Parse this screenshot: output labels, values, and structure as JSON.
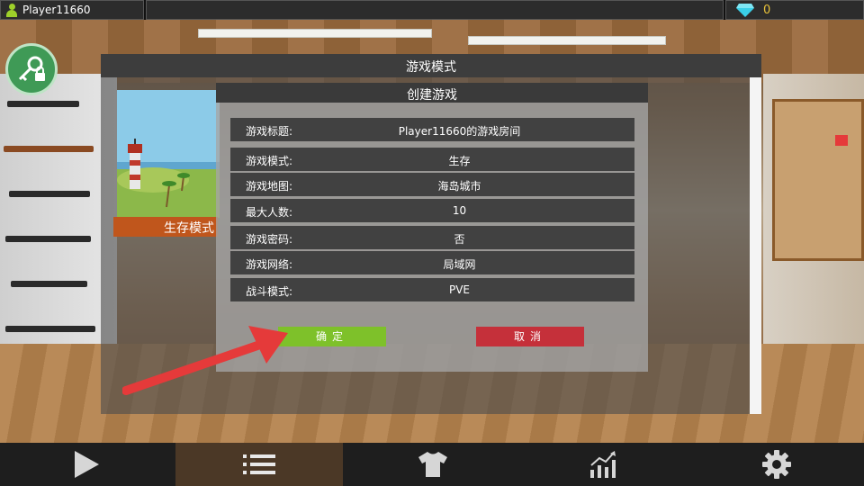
{
  "top_bar": {
    "player_name": "Player11660",
    "gem_count": "0",
    "gem_icon": "diamond-icon",
    "player_icon": "player-icon"
  },
  "key_button": {
    "icon": "key-lock-icon"
  },
  "dialog": {
    "title": "游戏模式",
    "mode_card": {
      "label": "生存模式"
    }
  },
  "create_game": {
    "title": "创建游戏",
    "rows": [
      {
        "label": "游戏标题:",
        "value": "Player11660的游戏房间"
      },
      {
        "label": "游戏模式:",
        "value": "生存"
      },
      {
        "label": "游戏地图:",
        "value": "海岛城市"
      },
      {
        "label": "最大人数:",
        "value": "10"
      },
      {
        "label": "游戏密码:",
        "value": "否"
      },
      {
        "label": "游戏网络:",
        "value": "局域网"
      },
      {
        "label": "战斗模式:",
        "value": "PVE"
      }
    ],
    "confirm_label": "确定",
    "cancel_label": "取消"
  },
  "bottom_nav": {
    "items": [
      {
        "icon": "play-icon"
      },
      {
        "icon": "list-icon",
        "active": true
      },
      {
        "icon": "shirt-icon"
      },
      {
        "icon": "stats-chart-icon"
      },
      {
        "icon": "gear-icon"
      }
    ]
  },
  "colors": {
    "confirm": "#7ec12a",
    "cancel": "#c5303a",
    "mode_label": "#c0561c",
    "gem_count": "#e8c23a",
    "arrow": "#e53a3a"
  }
}
